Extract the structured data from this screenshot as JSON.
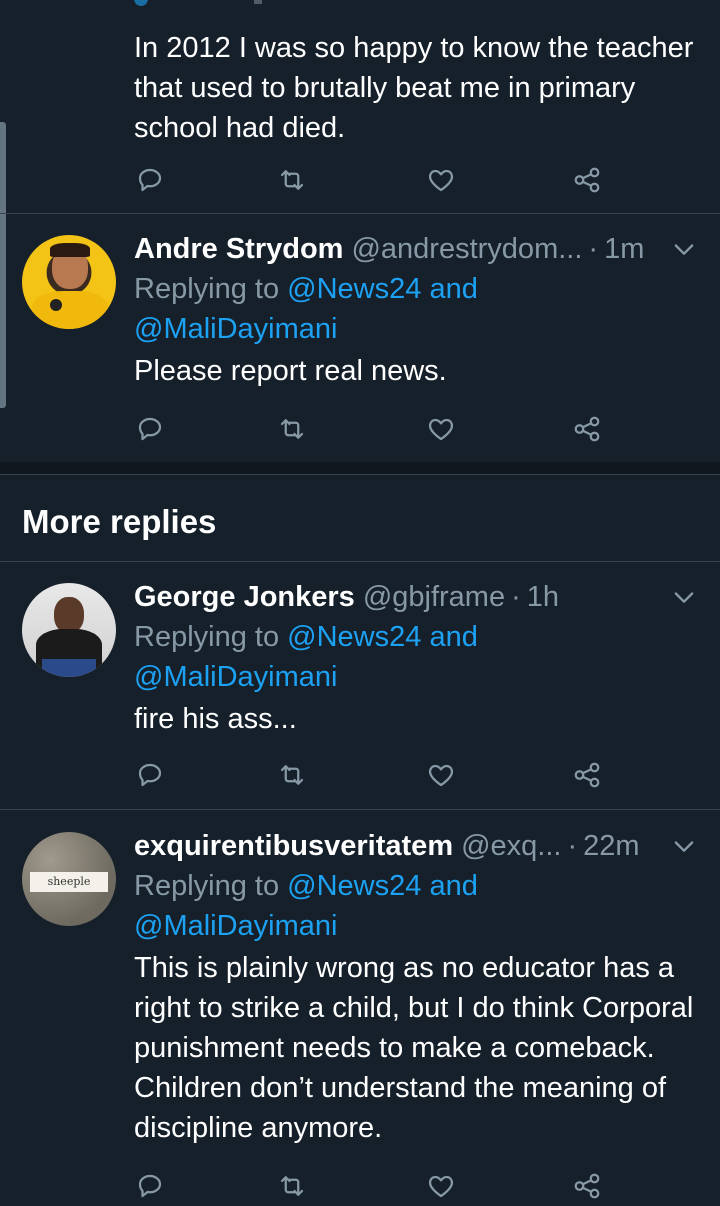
{
  "tweets": [
    {
      "text": "In 2012 I was so happy to know the teacher that used to brutally beat me in primary school had died."
    },
    {
      "name": "Andre Strydom",
      "handle": "@andrestrydom...",
      "time": "1m",
      "replying_prefix": "Replying to",
      "mention1": "@News24",
      "and": "and",
      "mention2": "@MaliDayimani",
      "text": "Please report real news."
    },
    {
      "name": "George Jonkers",
      "handle": "@gbjframe",
      "time": "1h",
      "replying_prefix": "Replying to",
      "mention1": "@News24",
      "and": "and",
      "mention2": "@MaliDayimani",
      "text": "fire his ass..."
    },
    {
      "name": "exquirentibusveritatem",
      "handle": "@exq...",
      "time": "22m",
      "replying_prefix": "Replying to",
      "mention1": "@News24",
      "and": "and",
      "mention2": "@MaliDayimani",
      "text": "This is plainly wrong as no educator has a right to strike a child, but I do think Corporal punishment needs to make a comeback. Children don’t understand the meaning of discipline anymore.",
      "avatar_text": "sheeple"
    }
  ],
  "section": {
    "title": "More replies"
  },
  "separator": "·",
  "colors": {
    "background": "#15202b",
    "accent": "#1da1f2",
    "muted": "#8899a6",
    "divider": "#38444d"
  },
  "icons": [
    "reply-icon",
    "retweet-icon",
    "like-icon",
    "share-icon",
    "chevron-down-icon"
  ]
}
